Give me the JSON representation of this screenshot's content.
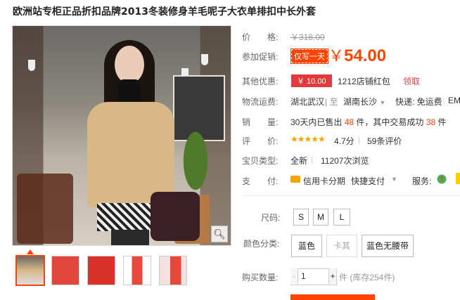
{
  "title": "欧洲站专柜正品折扣品牌2013冬装修身羊毛呢子大衣单排扣中长外套",
  "price": {
    "label": "价　　格:",
    "original": "￥318.00"
  },
  "promo": {
    "label": "参加促销:",
    "tag": "仅写一天",
    "currency": "￥",
    "price": "54.00"
  },
  "offers": {
    "label": "其他优惠:",
    "coupon": "￥ 10.00",
    "text": "1212店铺红包",
    "link": "领取"
  },
  "shipping": {
    "label": "物流运费:",
    "from": "湖北武汉",
    "sep": "| 至",
    "to": "湖南长沙",
    "fee": "快递: 免运费",
    "extra": "EM"
  },
  "sales": {
    "label": "销　　量:",
    "pre": "30天内已售出",
    "sold": "48",
    "mid": "件，其中交易成功",
    "success": "38",
    "unit": "件"
  },
  "rating": {
    "label": "评　　价:",
    "stars": "★★★★★",
    "score": "4.7分",
    "reviews": "59条评价"
  },
  "item_type": {
    "label": "宝贝类型:",
    "type": "全新",
    "views": "11207次浏览"
  },
  "payment": {
    "label": "支　　付:",
    "card": "信用卡分期",
    "quick": "快捷支付",
    "service": "服务:"
  },
  "size": {
    "label": "尺码:",
    "options": [
      "S",
      "M",
      "L"
    ]
  },
  "color": {
    "label": "颜色分类:",
    "options": [
      "蓝色",
      "卡其",
      "蓝色无腰带"
    ]
  },
  "quantity": {
    "label": "购买数量:",
    "minus": "-",
    "value": "1",
    "plus": "+",
    "stock": "件 (库存254件)"
  },
  "zoom_icon": "magnifier-icon",
  "colors": {
    "accent": "#ff4400",
    "coupon": "#e4393c",
    "star": "#f8a400"
  }
}
